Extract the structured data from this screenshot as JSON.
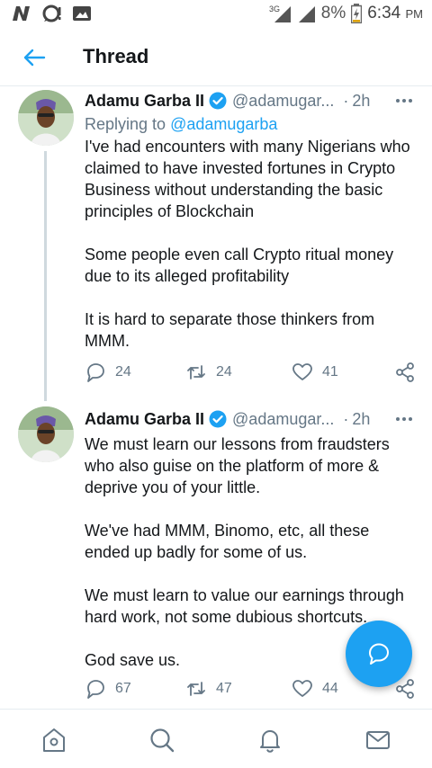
{
  "status_bar": {
    "left_icons": [
      "n-app-icon",
      "chat-icon",
      "image-icon"
    ],
    "network": "3G",
    "battery": "8%",
    "time": "6:34",
    "time_suffix": "PM"
  },
  "header": {
    "title": "Thread"
  },
  "tweets": [
    {
      "name": "Adamu Garba II",
      "handle": "@adamugar...",
      "separator": "·",
      "time": "2h",
      "reply_prefix": "Replying to",
      "reply_mention": "@adamugarba",
      "text": "I've had encounters with many Nigerians who claimed to have invested fortunes in Crypto Business without understanding the basic principles of Blockchain\n\nSome people even call Crypto ritual money due to its alleged profitability\n\nIt is hard to separate those thinkers from MMM.",
      "replies": "24",
      "retweets": "24",
      "likes": "41"
    },
    {
      "name": "Adamu Garba II",
      "handle": "@adamugar...",
      "separator": "·",
      "time": "2h",
      "text": "We must learn our lessons from fraudsters who also guise on the platform of more & deprive you of your little.\n\nWe've had MMM, Binomo, etc, all these ended up badly for some of us.\n\nWe must learn to value our earnings through hard work, not some dubious shortcuts.\n\nGod save us.",
      "replies": "67",
      "retweets": "47",
      "likes": "44"
    }
  ],
  "colors": {
    "accent": "#1da1f2",
    "secondary_text": "#657786",
    "divider": "#e6ecf0"
  },
  "bottom_nav": [
    "home-icon",
    "search-icon",
    "notifications-icon",
    "messages-icon"
  ]
}
